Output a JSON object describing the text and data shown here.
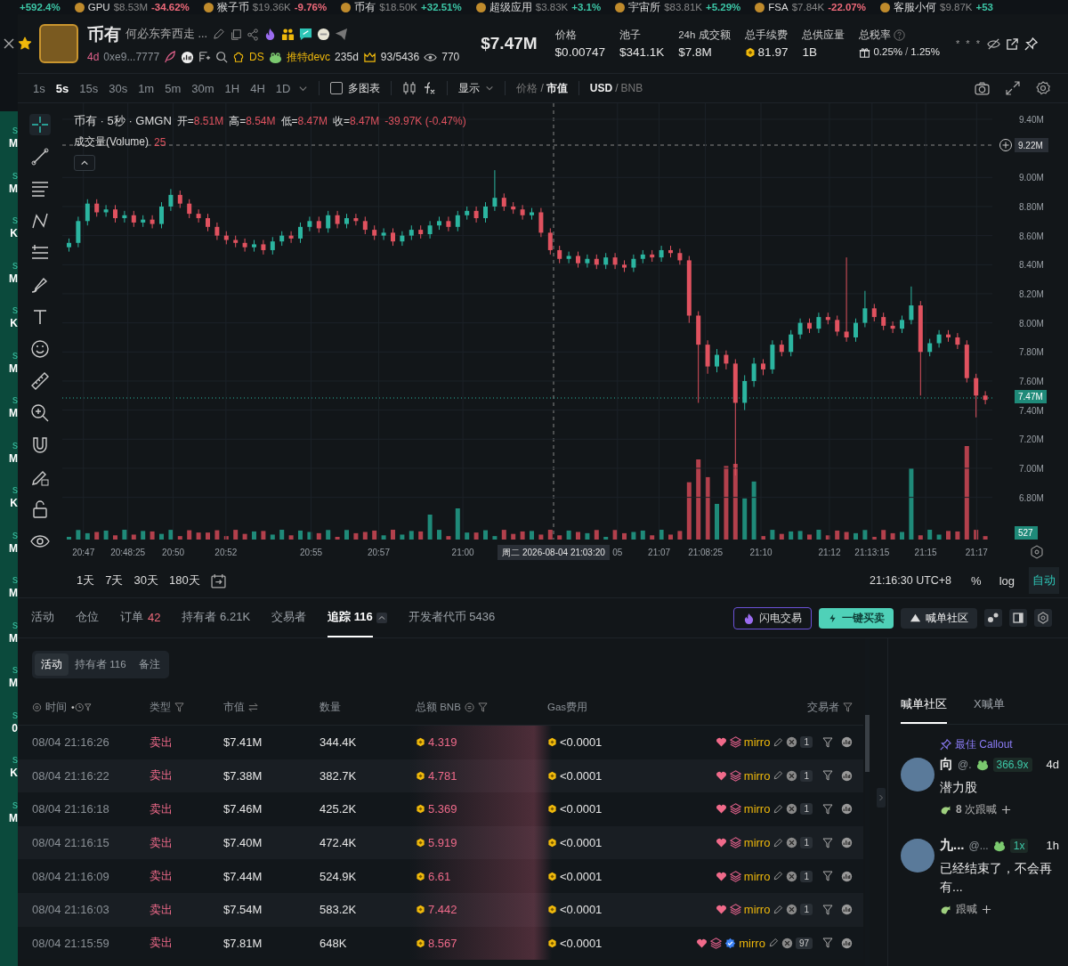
{
  "side_list": [
    {
      "age": "s",
      "value": "M"
    },
    {
      "age": "s",
      "value": "M"
    },
    {
      "age": "s",
      "value": "K"
    },
    {
      "age": "s",
      "value": "M"
    },
    {
      "age": "s",
      "value": "K"
    },
    {
      "age": "s",
      "value": "M"
    },
    {
      "age": "s",
      "value": "M"
    },
    {
      "age": "s",
      "value": "M"
    },
    {
      "age": "s",
      "value": "K"
    },
    {
      "age": "s",
      "value": "M"
    },
    {
      "age": "s",
      "value": "M"
    },
    {
      "age": "s",
      "value": "M"
    },
    {
      "age": "s",
      "value": "M"
    },
    {
      "age": "s",
      "value": "0"
    },
    {
      "age": "s",
      "value": "K"
    },
    {
      "age": "s",
      "value": "M"
    }
  ],
  "ticker": [
    {
      "change": "+592.4%",
      "color": "#3cc6a6"
    },
    {
      "name": "GPU",
      "price": "$8.53M",
      "change": "-34.62%",
      "color": "#ef6a7a"
    },
    {
      "name": "猴子币",
      "price": "$19.36K",
      "change": "-9.76%",
      "color": "#ef6a7a"
    },
    {
      "name": "币有",
      "price": "$18.50K",
      "change": "+32.51%",
      "color": "#3cc6a6"
    },
    {
      "name": "超级应用",
      "price": "$3.83K",
      "change": "+3.1%",
      "color": "#3cc6a6"
    },
    {
      "name": "宇宙所",
      "price": "$83.81K",
      "change": "+5.29%",
      "color": "#3cc6a6"
    },
    {
      "name": "FSA",
      "price": "$7.84K",
      "change": "-22.07%",
      "color": "#ef6a7a"
    },
    {
      "name": "客服小何",
      "price": "$9.87K",
      "change": "+53",
      "color": "#3cc6a6"
    }
  ],
  "token": {
    "name": "币有",
    "description": "何必东奔西走 ...",
    "favorited": true,
    "age": "4d",
    "address": "0xe9...7777",
    "dev_tag": "DS",
    "twitter_label": "推特devc",
    "twitter_age": "235d",
    "holders_ratio": "93/5436",
    "views": "770"
  },
  "market_cap": "$7.47M",
  "stats": [
    {
      "label": "价格",
      "value": "$0.00747",
      "kind": "plain"
    },
    {
      "label": "池子",
      "value": "$341.1K",
      "kind": "plain"
    },
    {
      "label": "24h 成交额",
      "value": "$7.8M",
      "kind": "plain"
    },
    {
      "label": "总手续费",
      "value": "81.97",
      "kind": "bnb"
    },
    {
      "label": "总供应量",
      "value": "1B",
      "kind": "plain"
    },
    {
      "label": "总税率",
      "value": "0.25%",
      "separator": "/",
      "value2": "1.25%",
      "kind": "tax"
    }
  ],
  "masked": "* * *",
  "intervals": [
    {
      "label": "1s",
      "selected": false
    },
    {
      "label": "5s",
      "selected": true
    },
    {
      "label": "15s",
      "selected": false
    },
    {
      "label": "30s",
      "selected": false
    },
    {
      "label": "1m",
      "selected": false
    },
    {
      "label": "5m",
      "selected": false
    },
    {
      "label": "30m",
      "selected": false
    },
    {
      "label": "1H",
      "selected": false
    },
    {
      "label": "4H",
      "selected": false
    },
    {
      "label": "1D",
      "selected": false
    }
  ],
  "multi_chart": {
    "label": "多图表",
    "checked": false
  },
  "display_menu": "显示",
  "price_mode": {
    "separator": "/",
    "options": [
      {
        "label": "价格",
        "selected": false
      },
      {
        "label": "市值",
        "selected": true
      }
    ]
  },
  "currency": {
    "separator": "/",
    "options": [
      {
        "label": "USD",
        "selected": true
      },
      {
        "label": "BNB",
        "selected": false
      }
    ]
  },
  "chart": {
    "legend_title": "币有 · 5秒 · GMGN",
    "ohlc_legend": [
      {
        "label": "开=",
        "value": "8.51M"
      },
      {
        "label": "高=",
        "value": "8.54M"
      },
      {
        "label": "低=",
        "value": "8.47M"
      },
      {
        "label": "收=",
        "value": "8.47M"
      }
    ],
    "change": "-39.97K (-0.47%)",
    "volume_label": "成交量(Volume)",
    "volume_value": "25",
    "crosshair_price": "9.22M",
    "last_price": "7.47M",
    "volume_badge": "527",
    "crosshair_time": "周二 2026-08-04 21:03:20",
    "x_labels": [
      "20:47",
      "20:48:25",
      "20:50",
      "20:52",
      "20:55",
      "20:57",
      "21:00",
      "05",
      "21:07",
      "21:08:25",
      "21:10",
      "21:12",
      "21:13:15",
      "21:15",
      "21:17"
    ],
    "chart_data": {
      "type": "candlestick",
      "yticks": [
        {
          "value": 9.4,
          "label": "9.40M"
        },
        {
          "value": 9.0,
          "label": "9.00M"
        },
        {
          "value": 8.8,
          "label": "8.80M"
        },
        {
          "value": 8.6,
          "label": "8.60M"
        },
        {
          "value": 8.4,
          "label": "8.40M"
        },
        {
          "value": 8.2,
          "label": "8.20M"
        },
        {
          "value": 8.0,
          "label": "8.00M"
        },
        {
          "value": 7.8,
          "label": "7.80M"
        },
        {
          "value": 7.6,
          "label": "7.60M"
        },
        {
          "value": 7.4,
          "label": "7.40M"
        },
        {
          "value": 7.2,
          "label": "7.20M"
        },
        {
          "value": 7.0,
          "label": "7.00M"
        },
        {
          "value": 6.8,
          "label": "6.80M"
        }
      ],
      "ylim": [
        6.51,
        9.51
      ],
      "grid": true,
      "ohlc": [
        [
          8.52,
          8.58,
          8.49,
          8.55
        ],
        [
          8.55,
          8.73,
          8.52,
          8.7
        ],
        [
          8.7,
          8.85,
          8.67,
          8.82
        ],
        [
          8.82,
          8.85,
          8.73,
          8.76
        ],
        [
          8.76,
          8.81,
          8.73,
          8.78
        ],
        [
          8.78,
          8.81,
          8.69,
          8.72
        ],
        [
          8.72,
          8.77,
          8.69,
          8.74
        ],
        [
          8.74,
          8.77,
          8.66,
          8.69
        ],
        [
          8.69,
          8.74,
          8.66,
          8.71
        ],
        [
          8.71,
          8.74,
          8.65,
          8.68
        ],
        [
          8.68,
          8.83,
          8.65,
          8.8
        ],
        [
          8.8,
          8.92,
          8.77,
          8.88
        ],
        [
          8.88,
          8.91,
          8.79,
          8.82
        ],
        [
          8.82,
          8.85,
          8.72,
          8.75
        ],
        [
          8.75,
          8.78,
          8.69,
          8.72
        ],
        [
          8.72,
          8.75,
          8.63,
          8.66
        ],
        [
          8.66,
          8.69,
          8.57,
          8.6
        ],
        [
          8.6,
          8.63,
          8.54,
          8.57
        ],
        [
          8.57,
          8.6,
          8.52,
          8.55
        ],
        [
          8.55,
          8.58,
          8.49,
          8.52
        ],
        [
          8.52,
          8.57,
          8.49,
          8.54
        ],
        [
          8.54,
          8.57,
          8.47,
          8.5
        ],
        [
          8.5,
          8.59,
          8.47,
          8.56
        ],
        [
          8.56,
          8.63,
          8.53,
          8.6
        ],
        [
          8.6,
          8.63,
          8.55,
          8.58
        ],
        [
          8.58,
          8.69,
          8.55,
          8.66
        ],
        [
          8.66,
          8.73,
          8.63,
          8.7
        ],
        [
          8.7,
          8.73,
          8.62,
          8.65
        ],
        [
          8.65,
          8.77,
          8.62,
          8.74
        ],
        [
          8.74,
          8.77,
          8.65,
          8.68
        ],
        [
          8.68,
          8.75,
          8.65,
          8.72
        ],
        [
          8.72,
          8.75,
          8.67,
          8.7
        ],
        [
          8.7,
          8.73,
          8.61,
          8.64
        ],
        [
          8.64,
          8.67,
          8.57,
          8.6
        ],
        [
          8.6,
          8.65,
          8.57,
          8.62
        ],
        [
          8.62,
          8.65,
          8.53,
          8.56
        ],
        [
          8.56,
          8.63,
          8.53,
          8.6
        ],
        [
          8.6,
          8.67,
          8.57,
          8.64
        ],
        [
          8.64,
          8.67,
          8.58,
          8.61
        ],
        [
          8.61,
          8.7,
          8.58,
          8.67
        ],
        [
          8.67,
          8.73,
          8.64,
          8.7
        ],
        [
          8.7,
          8.73,
          8.63,
          8.66
        ],
        [
          8.66,
          8.77,
          8.63,
          8.74
        ],
        [
          8.74,
          8.8,
          8.71,
          8.77
        ],
        [
          8.77,
          8.8,
          8.69,
          8.72
        ],
        [
          8.72,
          8.83,
          8.69,
          8.8
        ],
        [
          8.8,
          9.05,
          8.77,
          8.86
        ],
        [
          8.86,
          8.89,
          8.77,
          8.8
        ],
        [
          8.8,
          8.83,
          8.75,
          8.78
        ],
        [
          8.78,
          8.81,
          8.71,
          8.74
        ],
        [
          8.74,
          8.79,
          8.71,
          8.76
        ],
        [
          8.76,
          8.79,
          8.59,
          8.62
        ],
        [
          8.62,
          8.65,
          8.47,
          8.5
        ],
        [
          8.5,
          8.53,
          8.41,
          8.44
        ],
        [
          8.44,
          8.49,
          8.41,
          8.46
        ],
        [
          8.46,
          8.49,
          8.38,
          8.41
        ],
        [
          8.41,
          8.47,
          8.38,
          8.44
        ],
        [
          8.44,
          8.47,
          8.37,
          8.4
        ],
        [
          8.4,
          8.48,
          8.37,
          8.45
        ],
        [
          8.45,
          8.48,
          8.37,
          8.4
        ],
        [
          8.4,
          8.43,
          8.35,
          8.38
        ],
        [
          8.38,
          8.47,
          8.35,
          8.44
        ],
        [
          8.44,
          8.5,
          8.41,
          8.47
        ],
        [
          8.47,
          8.5,
          8.42,
          8.45
        ],
        [
          8.45,
          8.53,
          8.42,
          8.5
        ],
        [
          8.5,
          8.53,
          8.45,
          8.48
        ],
        [
          8.48,
          8.51,
          8.4,
          8.43
        ],
        [
          8.43,
          8.46,
          8.0,
          8.05
        ],
        [
          8.05,
          8.08,
          7.45,
          7.85
        ],
        [
          7.85,
          7.88,
          7.65,
          7.7
        ],
        [
          7.7,
          7.82,
          7.66,
          7.78
        ],
        [
          7.78,
          7.81,
          7.68,
          7.72
        ],
        [
          7.72,
          7.75,
          6.95,
          7.45
        ],
        [
          7.45,
          7.64,
          7.4,
          7.6
        ],
        [
          7.6,
          7.76,
          7.56,
          7.72
        ],
        [
          7.72,
          7.75,
          7.64,
          7.68
        ],
        [
          7.68,
          7.88,
          7.65,
          7.85
        ],
        [
          7.85,
          7.88,
          7.77,
          7.8
        ],
        [
          7.8,
          7.95,
          7.77,
          7.92
        ],
        [
          7.92,
          8.03,
          7.89,
          8.0
        ],
        [
          8.0,
          8.03,
          7.93,
          7.96
        ],
        [
          7.96,
          8.07,
          7.93,
          8.04
        ],
        [
          8.04,
          8.07,
          7.99,
          8.02
        ],
        [
          8.02,
          8.05,
          7.91,
          7.94
        ],
        [
          7.94,
          8.45,
          7.87,
          7.9
        ],
        [
          7.9,
          8.03,
          7.87,
          8.0
        ],
        [
          8.0,
          8.22,
          7.97,
          8.1
        ],
        [
          8.1,
          8.13,
          8.01,
          8.04
        ],
        [
          8.04,
          8.07,
          7.95,
          7.98
        ],
        [
          7.98,
          8.01,
          7.93,
          7.96
        ],
        [
          7.96,
          8.05,
          7.93,
          8.02
        ],
        [
          8.02,
          8.25,
          7.99,
          8.12
        ],
        [
          8.12,
          8.15,
          7.5,
          7.8
        ],
        [
          7.8,
          7.89,
          7.77,
          7.86
        ],
        [
          7.86,
          7.95,
          7.83,
          7.92
        ],
        [
          7.92,
          7.95,
          7.87,
          7.9
        ],
        [
          7.9,
          7.93,
          7.82,
          7.85
        ],
        [
          7.85,
          7.88,
          7.59,
          7.62
        ],
        [
          7.62,
          7.65,
          7.35,
          7.5
        ],
        [
          7.5,
          7.53,
          7.44,
          7.47
        ]
      ]
    }
  },
  "ranges": [
    {
      "label": "1天"
    },
    {
      "label": "7天"
    },
    {
      "label": "30天"
    },
    {
      "label": "180天"
    }
  ],
  "clock": "21:16:30 UTC+8",
  "scale_modes": [
    {
      "label": "%",
      "selected": false
    },
    {
      "label": "log",
      "selected": false
    },
    {
      "label": "自动",
      "selected": true
    }
  ],
  "tabs": [
    {
      "label": "活动",
      "selected": false
    },
    {
      "label": "仓位",
      "selected": false
    },
    {
      "label": "订单",
      "count": "42",
      "selected": false
    },
    {
      "label": "持有者 6.21K",
      "selected": false
    },
    {
      "label": "交易者",
      "selected": false
    },
    {
      "label": "追踪 116",
      "selected": true
    },
    {
      "label": "开发者代币 5436",
      "selected": false
    }
  ],
  "actions": [
    {
      "label": "闪电交易",
      "kind": "outline"
    },
    {
      "label": "一键买卖",
      "kind": "filled"
    },
    {
      "label": "喊单社区",
      "kind": "plain"
    }
  ],
  "sub_tabs": [
    {
      "label": "活动",
      "selected": true
    },
    {
      "label": "持有者 116",
      "selected": false
    },
    {
      "label": "备注",
      "selected": false
    }
  ],
  "table": {
    "columns": [
      "时间",
      "类型",
      "市值",
      "数量",
      "总额 BNB",
      "Gas费用",
      "交易者"
    ],
    "rows": [
      {
        "time": "08/04 21:16:26",
        "type": "卖出",
        "color": "#ef6a8a",
        "market_cap": "$7.41M",
        "amount": "344.4K",
        "total": "4.319",
        "gas": "<0.0001",
        "trader": "mirro",
        "verified": false,
        "count": "1"
      },
      {
        "time": "08/04 21:16:22",
        "type": "卖出",
        "color": "#ef6a8a",
        "market_cap": "$7.38M",
        "amount": "382.7K",
        "total": "4.781",
        "gas": "<0.0001",
        "trader": "mirro",
        "verified": false,
        "count": "1"
      },
      {
        "time": "08/04 21:16:18",
        "type": "卖出",
        "color": "#ef6a8a",
        "market_cap": "$7.46M",
        "amount": "425.2K",
        "total": "5.369",
        "gas": "<0.0001",
        "trader": "mirro",
        "verified": false,
        "count": "1"
      },
      {
        "time": "08/04 21:16:15",
        "type": "卖出",
        "color": "#ef6a8a",
        "market_cap": "$7.40M",
        "amount": "472.4K",
        "total": "5.919",
        "gas": "<0.0001",
        "trader": "mirro",
        "verified": false,
        "count": "1"
      },
      {
        "time": "08/04 21:16:09",
        "type": "卖出",
        "color": "#ef6a8a",
        "market_cap": "$7.44M",
        "amount": "524.9K",
        "total": "6.61",
        "gas": "<0.0001",
        "trader": "mirro",
        "verified": false,
        "count": "1"
      },
      {
        "time": "08/04 21:16:03",
        "type": "卖出",
        "color": "#ef6a8a",
        "market_cap": "$7.54M",
        "amount": "583.2K",
        "total": "7.442",
        "gas": "<0.0001",
        "trader": "mirro",
        "verified": false,
        "count": "1"
      },
      {
        "time": "08/04 21:15:59",
        "type": "卖出",
        "color": "#ef6a8a",
        "market_cap": "$7.81M",
        "amount": "648K",
        "total": "8.567",
        "gas": "<0.0001",
        "trader": "mirro",
        "verified": true,
        "count": "97"
      }
    ]
  },
  "community": {
    "tabs": [
      {
        "label": "喊单社区",
        "selected": true
      },
      {
        "label": "X喊单",
        "selected": false
      }
    ],
    "pinned_label": "最佳 Callout",
    "posts": [
      {
        "name": "向",
        "handle": "@.",
        "multiplier": "366.9x",
        "age": "4d",
        "text": "潜力股",
        "follow": "**8** 次跟喊"
      },
      {
        "name": "九...",
        "handle": "@...",
        "multiplier": "1x",
        "age": "1h",
        "text": "已经结束了，不会再有...",
        "follow": "跟喊"
      }
    ]
  }
}
